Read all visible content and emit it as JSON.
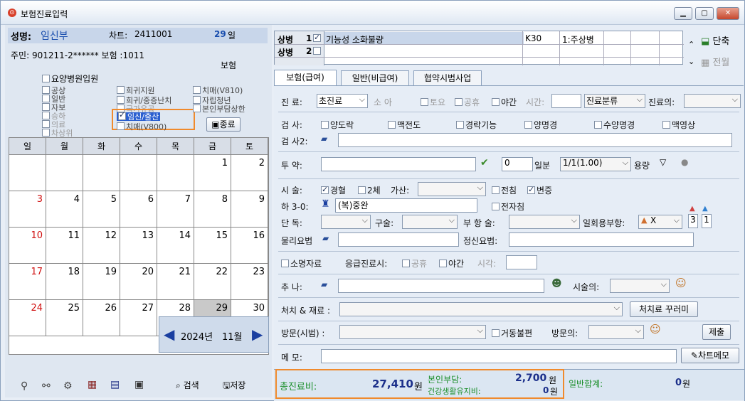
{
  "window": {
    "title": "보험진료입력",
    "icon": "app-icon"
  },
  "left": {
    "name_label": "성명:",
    "name": "임신부",
    "chart_label": "차트:",
    "chart": "2411001",
    "age": "29",
    "age_unit": "일",
    "id_line": "주민: 901211-2****** 보험 :1011",
    "insurance": "보험",
    "checkboxes": {
      "nursing": "요양병원입원",
      "c1": "공상",
      "c2": "일반",
      "c3": "자보",
      "c4": "승하",
      "c5": "의료",
      "c6": "차상위",
      "r1": "희귀지원",
      "r2": "희귀/중증난치",
      "r3": "국가유공",
      "r4": "임신/출산",
      "r5": "치매(V800)",
      "s1": "치매(V810)",
      "s2": "자립청년",
      "s3": "본인부담상한"
    },
    "close_label": "종료",
    "calendar": {
      "days": [
        "일",
        "월",
        "화",
        "수",
        "목",
        "금",
        "토"
      ],
      "weeks": [
        [
          "",
          "",
          "",
          "",
          "",
          "1",
          "2"
        ],
        [
          "3",
          "4",
          "5",
          "6",
          "7",
          "8",
          "9"
        ],
        [
          "10",
          "11",
          "12",
          "13",
          "14",
          "15",
          "16"
        ],
        [
          "17",
          "18",
          "19",
          "20",
          "21",
          "22",
          "23"
        ],
        [
          "24",
          "25",
          "26",
          "27",
          "28",
          "29",
          "30"
        ]
      ],
      "year": "2024년",
      "month": "11월"
    },
    "search_label": "검색",
    "save_label": "저장"
  },
  "diag": {
    "col1": "상병",
    "rows": [
      {
        "no": "1",
        "name": "기능성 소화불량",
        "code": "K30",
        "type": "1:주상병"
      },
      {
        "no": "2",
        "name": "",
        "code": "",
        "type": ""
      }
    ],
    "single_label": "단축",
    "prev_label": "전월"
  },
  "tabs": [
    "보험(급여)",
    "일반(비급여)",
    "협약시범사업"
  ],
  "form": {
    "visit_label": "진    료:",
    "visit_value": "초진료",
    "small_child": "소 아",
    "sat": "토요",
    "holiday": "공휴",
    "night": "야간",
    "time_label": "시간:",
    "class_value": "진료분류",
    "doctor_label": "진료의:",
    "test_label": "검    사:",
    "tests": [
      "양도락",
      "맥전도",
      "경락기능",
      "양명경",
      "수양명경",
      "맥영상"
    ],
    "test2_label": "검 사2:",
    "med_label": "투    약:",
    "days_value": "0",
    "days_unit": "일분",
    "dose_value": "1/1(1.00)",
    "dose_unit": "용량",
    "acu_label": "시    술:",
    "acu1": "경혈",
    "acu2": "2체",
    "add_label": "가산:",
    "acu3": "전침",
    "acu4": "변증",
    "ha_label": "하 3-0:",
    "ha_value": "(복)중완",
    "ha_chk": "전자침",
    "dan_label": "단    독:",
    "gu_label": "구술:",
    "bu_label": "부 항 술:",
    "daily_label": "일회용부항:",
    "daily_value": "X",
    "n1": "3",
    "n2": "1",
    "pt_label": "물리요법",
    "mental_label": "정신요법:",
    "sm1": "소명자료",
    "emerg_label": "응급진료시:",
    "emerg_hol": "공휴",
    "emerg_night": "야간",
    "emerg_time": "시각:",
    "chu_label": "추    나:",
    "op_doctor": "시술의:",
    "mat_label": "처치 & 재료 :",
    "mat_btn": "처치료 꾸러미",
    "visit2_label": "방문(시범) :",
    "home": "거동불편",
    "visit_doc": "방문의:",
    "submit": "제출",
    "memo_label": "메    모:",
    "chart_memo": "차트메모"
  },
  "totals": {
    "total_label": "총진료비:",
    "total": "27,410",
    "won": "원",
    "self_label": "본인부담:",
    "self": "2,700",
    "self_won": "원",
    "health_label": "건강생활유지비:",
    "health": "0",
    "health_won": "원",
    "general_label": "일반합계:",
    "general": "0",
    "general_won": "원"
  },
  "colors": {
    "highlight": "#f08a2c",
    "name_blue": "#1b4fae",
    "sunday": "#d01010",
    "total_green": "#1b8f2a"
  }
}
